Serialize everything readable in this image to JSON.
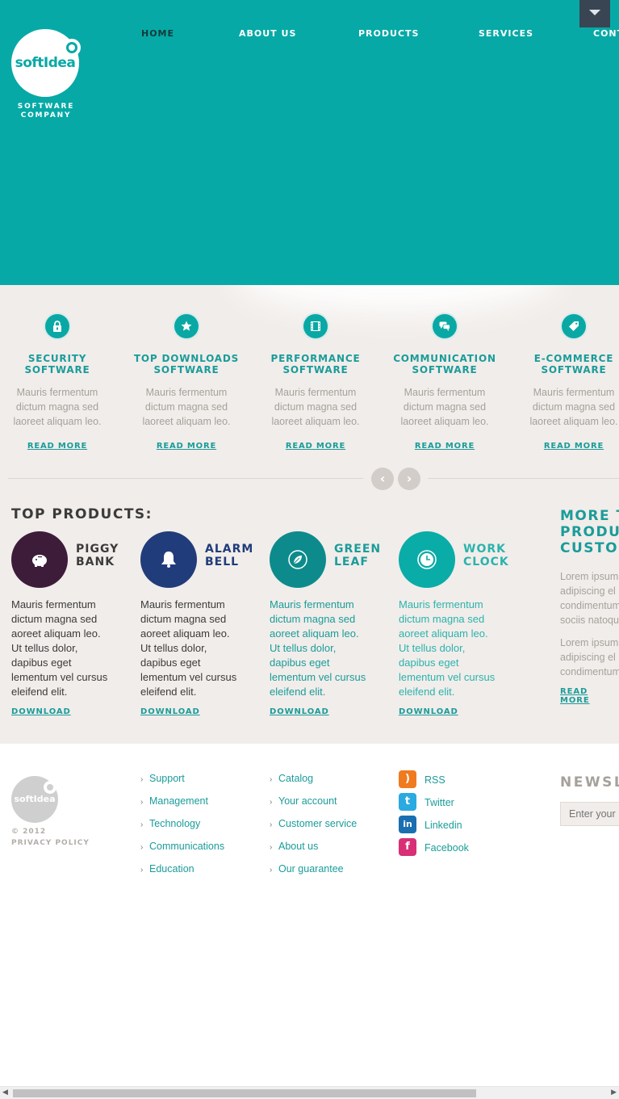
{
  "brand": {
    "name": "softIdea",
    "tagline_line1": "SOFTWARE",
    "tagline_line2": "COMPANY",
    "accent": "#06a9a6"
  },
  "nav": {
    "items": [
      "HOME",
      "ABOUT US",
      "PRODUCTS",
      "SERVICES",
      "CONT"
    ],
    "active": "HOME",
    "menu_icon": "caret-down-icon"
  },
  "features": [
    {
      "icon": "lock-icon",
      "title_line1": "SECURITY",
      "title_line2": "SOFTWARE",
      "text_line1": "Mauris fermentum",
      "text_line2": "dictum magna sed",
      "text_line3": "laoreet aliquam leo.",
      "link": "READ MORE"
    },
    {
      "icon": "star-icon",
      "title_line1": "TOP DOWNLOADS",
      "title_line2": "SOFTWARE",
      "text_line1": "Mauris fermentum",
      "text_line2": "dictum magna sed",
      "text_line3": "laoreet aliquam leo.",
      "link": "READ MORE"
    },
    {
      "icon": "film-icon",
      "title_line1": "PERFORMANCE",
      "title_line2": "SOFTWARE",
      "text_line1": "Mauris fermentum",
      "text_line2": "dictum magna sed",
      "text_line3": "laoreet aliquam leo.",
      "link": "READ MORE"
    },
    {
      "icon": "chat-icon",
      "title_line1": "COMMUNICATION",
      "title_line2": "SOFTWARE",
      "text_line1": "Mauris fermentum",
      "text_line2": "dictum magna sed",
      "text_line3": "laoreet aliquam leo.",
      "link": "READ MORE"
    },
    {
      "icon": "tag-icon",
      "title_line1": "E-COMMERCE",
      "title_line2": "SOFTWARE",
      "text_line1": "Mauris fermentum",
      "text_line2": "dictum magna sed",
      "text_line3": "laoreet aliquam leo.",
      "link": "READ MORE"
    }
  ],
  "carousel": {
    "prev": "‹",
    "next": "›"
  },
  "top_products": {
    "title": "TOP PRODUCTS:",
    "items": [
      {
        "name_line1": "PIGGY",
        "name_line2": "BANK",
        "icon": "piggy-bank-icon",
        "color": "#3d1c3a",
        "text_color": "#3b3b3b",
        "lines": [
          "Mauris fermentum",
          "dictum magna sed",
          "aoreet aliquam leo.",
          "Ut tellus dolor,",
          "dapibus eget",
          "lementum vel cursus",
          "eleifend elit."
        ],
        "download": "DOWNLOAD"
      },
      {
        "name_line1": "ALARM",
        "name_line2": "BELL",
        "icon": "bell-icon",
        "color": "#213c7a",
        "text_color": "#3b3b3b",
        "lines": [
          "Mauris fermentum",
          "dictum magna sed",
          "aoreet aliquam leo.",
          "Ut tellus dolor,",
          "dapibus eget",
          "lementum vel cursus",
          "eleifend elit."
        ],
        "download": "DOWNLOAD"
      },
      {
        "name_line1": "GREEN",
        "name_line2": "LEAF",
        "icon": "leaf-icon",
        "color": "#0d8b8c",
        "text_color": "#1a9c9a",
        "lines": [
          "Mauris fermentum",
          "dictum magna sed",
          "aoreet aliquam leo.",
          "Ut tellus dolor,",
          "dapibus eget",
          "lementum vel cursus",
          "eleifend elit."
        ],
        "download": "DOWNLOAD"
      },
      {
        "name_line1": "WORK",
        "name_line2": "CLOCK",
        "icon": "clock-icon",
        "color": "#0aaca7",
        "text_color": "#2bb3ad",
        "lines": [
          "Mauris fermentum",
          "dictum magna sed",
          "aoreet aliquam leo.",
          "Ut tellus dolor,",
          "dapibus eget",
          "lementum vel cursus",
          "eleifend elit."
        ],
        "download": "DOWNLOAD"
      }
    ]
  },
  "more": {
    "title_line1": "MORE T",
    "title_line2": "PRODU",
    "title_line3": "CUSTO",
    "para1": [
      "Lorem ipsum",
      "adipiscing el",
      "condimentum",
      "sociis natoqu"
    ],
    "para2": [
      "Lorem ipsum",
      "adipiscing el",
      "condimentum"
    ],
    "link": "READ MORE"
  },
  "footer": {
    "logo_text": "softIdea",
    "copyright": "© 2012",
    "privacy": "PRIVACY POLICY",
    "col1": [
      "Support",
      "Management",
      "Technology",
      "Communications",
      "Education"
    ],
    "col2": [
      "Catalog",
      "Your account",
      "Customer service",
      "About us",
      "Our guarantee"
    ],
    "social": [
      {
        "label": "RSS",
        "icon": "rss-icon",
        "color": "#f07a20"
      },
      {
        "label": "Twitter",
        "icon": "twitter-icon",
        "color": "#2ba9e1"
      },
      {
        "label": "Linkedin",
        "icon": "linkedin-icon",
        "color": "#1a6fb0"
      },
      {
        "label": "Facebook",
        "icon": "facebook-icon",
        "color": "#d82f77"
      }
    ],
    "newsletter_title": "NEWSL",
    "newsletter_placeholder": "Enter your"
  }
}
